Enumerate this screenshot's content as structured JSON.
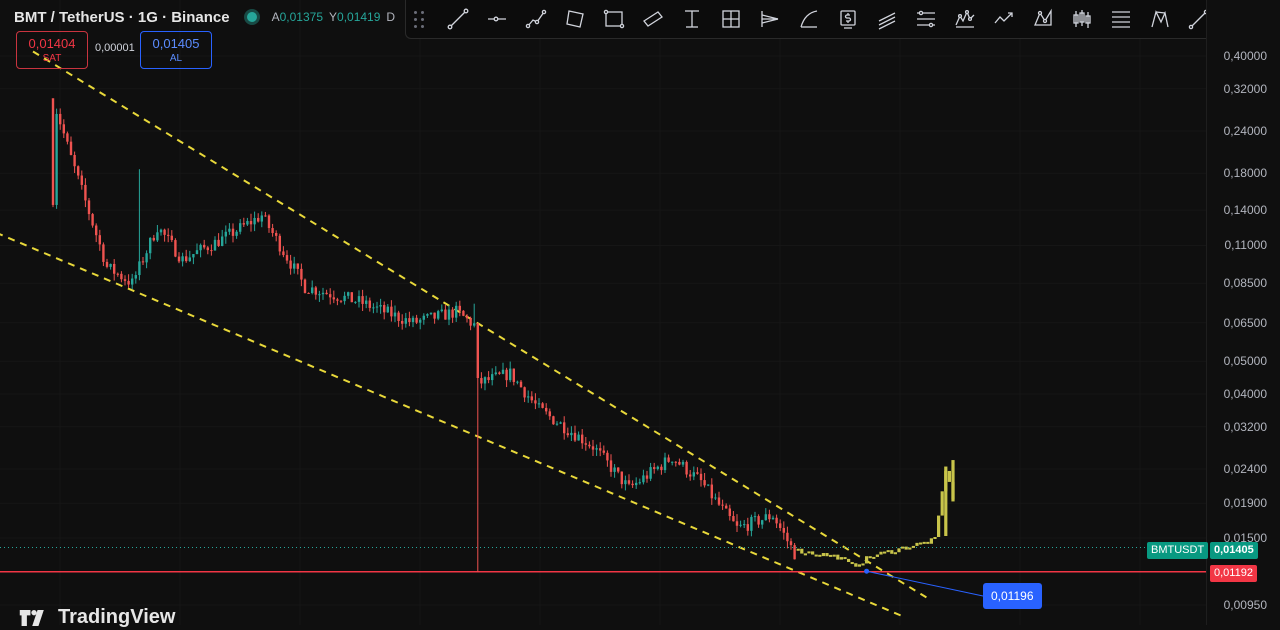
{
  "header": {
    "symbol": "BMT / TetherUS · 1G · Binance",
    "ohlc": [
      {
        "key": "A",
        "value": "0,01375"
      },
      {
        "key": "Y",
        "value": "0,01419"
      },
      {
        "key": "D",
        "value": ""
      }
    ]
  },
  "trade": {
    "sell_price": "0,01404",
    "sell_label": "SAT",
    "spread": "0,00001",
    "buy_price": "0,01405",
    "buy_label": "AL"
  },
  "toolbar": {
    "icons": [
      "trend-line-icon",
      "horizontal-ray-icon",
      "polyline-icon",
      "rotated-rectangle-icon",
      "rectangle-icon",
      "parallel-channel-icon",
      "anchored-text-icon",
      "grid-icon",
      "fib-fan-icon",
      "arc-icon",
      "price-label-icon",
      "pitchfork-icon",
      "fib-retracement-icon",
      "elliott-wave-icon",
      "path-icon",
      "pattern-icon",
      "candles-icon",
      "fib-channel-icon",
      "abcd-pattern-icon",
      "pencil-icon",
      "text-icon"
    ]
  },
  "axis": {
    "ticks": [
      "0,40000",
      "0,32000",
      "0,24000",
      "0,18000",
      "0,14000",
      "0,11000",
      "0,08500",
      "0,06500",
      "0,05000",
      "0,04000",
      "0,03200",
      "0,02400",
      "0,01900",
      "0,01500",
      "0,00950"
    ]
  },
  "tags": {
    "symbol_tag": "BMTUSDT",
    "current_price": "0,01405",
    "support_price": "0,01192",
    "pointer_price": "0,01196"
  },
  "brand": {
    "name": "TradingView"
  },
  "colors": {
    "up": "#26a69a",
    "down": "#ef5350",
    "forecast": "#c8c44a",
    "channel": "#e8d83a",
    "support": "#f23645",
    "pointer": "#2962ff"
  },
  "chart_data": {
    "type": "candlestick",
    "title": "BMT / TetherUS · 1G · Binance",
    "y_scale": "log",
    "ylim": [
      0.0085,
      0.46
    ],
    "y_ticks": [
      0.4,
      0.32,
      0.24,
      0.18,
      0.14,
      0.11,
      0.085,
      0.065,
      0.05,
      0.04,
      0.032,
      0.024,
      0.019,
      0.015,
      0.0095
    ],
    "close_path": [
      {
        "x": 0,
        "close": 0.3
      },
      {
        "x": 5,
        "close": 0.2
      },
      {
        "x": 15,
        "close": 0.095
      },
      {
        "x": 22,
        "close": 0.085
      },
      {
        "x": 29,
        "close": 0.125
      },
      {
        "x": 36,
        "close": 0.1
      },
      {
        "x": 47,
        "close": 0.115
      },
      {
        "x": 58,
        "close": 0.135
      },
      {
        "x": 70,
        "close": 0.083
      },
      {
        "x": 85,
        "close": 0.075
      },
      {
        "x": 100,
        "close": 0.065
      },
      {
        "x": 112,
        "close": 0.07
      },
      {
        "x": 117,
        "close": 0.064
      },
      {
        "x": 118,
        "close": 0.043
      },
      {
        "x": 127,
        "close": 0.046
      },
      {
        "x": 135,
        "close": 0.036
      },
      {
        "x": 150,
        "close": 0.028
      },
      {
        "x": 160,
        "close": 0.021
      },
      {
        "x": 172,
        "close": 0.026
      },
      {
        "x": 180,
        "close": 0.022
      },
      {
        "x": 190,
        "close": 0.016
      },
      {
        "x": 200,
        "close": 0.0175
      },
      {
        "x": 206,
        "close": 0.0135
      }
    ],
    "forecast_path": [
      {
        "x": 206,
        "close": 0.0138
      },
      {
        "x": 218,
        "close": 0.0132
      },
      {
        "x": 222,
        "close": 0.0124
      },
      {
        "x": 228,
        "close": 0.0133
      },
      {
        "x": 236,
        "close": 0.014
      },
      {
        "x": 245,
        "close": 0.0148
      },
      {
        "x": 248,
        "close": 0.024
      },
      {
        "x": 250,
        "close": 0.0195
      }
    ],
    "annotations": {
      "channel_upper": [
        [
          0,
          0.36
        ],
        [
          244,
          0.0098
        ]
      ],
      "channel_lower": [
        [
          -13,
          0.12
        ],
        [
          236,
          0.0088
        ]
      ],
      "support_level": 0.01192,
      "current_price": 0.01405,
      "pointer": {
        "from": [
          226,
          0.01196
        ],
        "label": "0,01196"
      }
    }
  }
}
